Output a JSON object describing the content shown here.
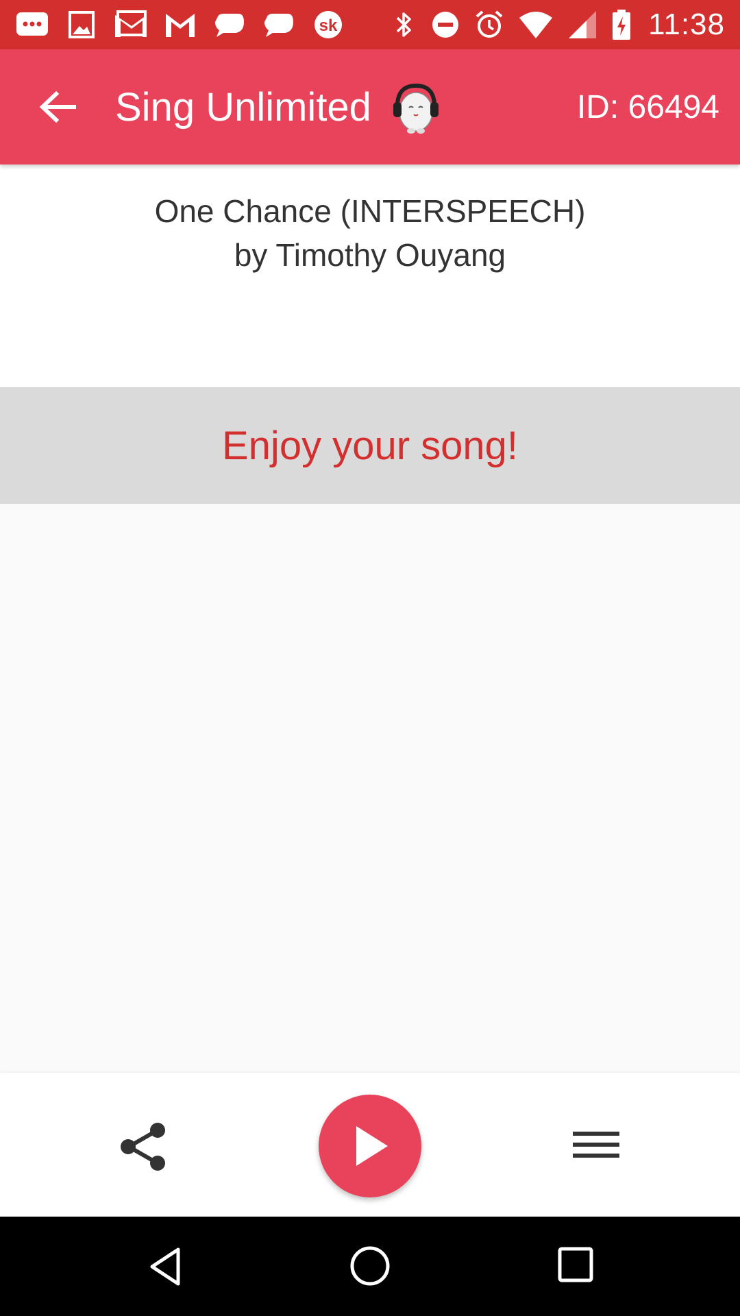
{
  "status_bar": {
    "time": "11:38",
    "notification_icons": [
      "messages-icon",
      "image-icon",
      "gmail-icon",
      "gmail-icon",
      "chat-bubble-icon",
      "chat-bubble-icon",
      "sk-app-icon"
    ],
    "system_icons": [
      "bluetooth-icon",
      "do-not-disturb-icon",
      "alarm-icon",
      "wifi-icon",
      "signal-icon",
      "battery-charging-icon"
    ],
    "color": "#d32f2f"
  },
  "app_bar": {
    "title": "Sing Unlimited",
    "device_id": "ID: 66494",
    "color": "#e8435a"
  },
  "song": {
    "title": "One Chance (INTERSPEECH)",
    "artist": "by Timothy Ouyang"
  },
  "banner": {
    "text": "Enjoy your song!",
    "text_color": "#d32f2f",
    "background": "#dadada"
  },
  "toolbar": {
    "icons": [
      "share-icon",
      "play-icon",
      "menu-icon"
    ],
    "accent": "#e8435a"
  },
  "nav_bar": {
    "icons": [
      "nav-back-icon",
      "nav-home-icon",
      "nav-recents-icon"
    ]
  }
}
